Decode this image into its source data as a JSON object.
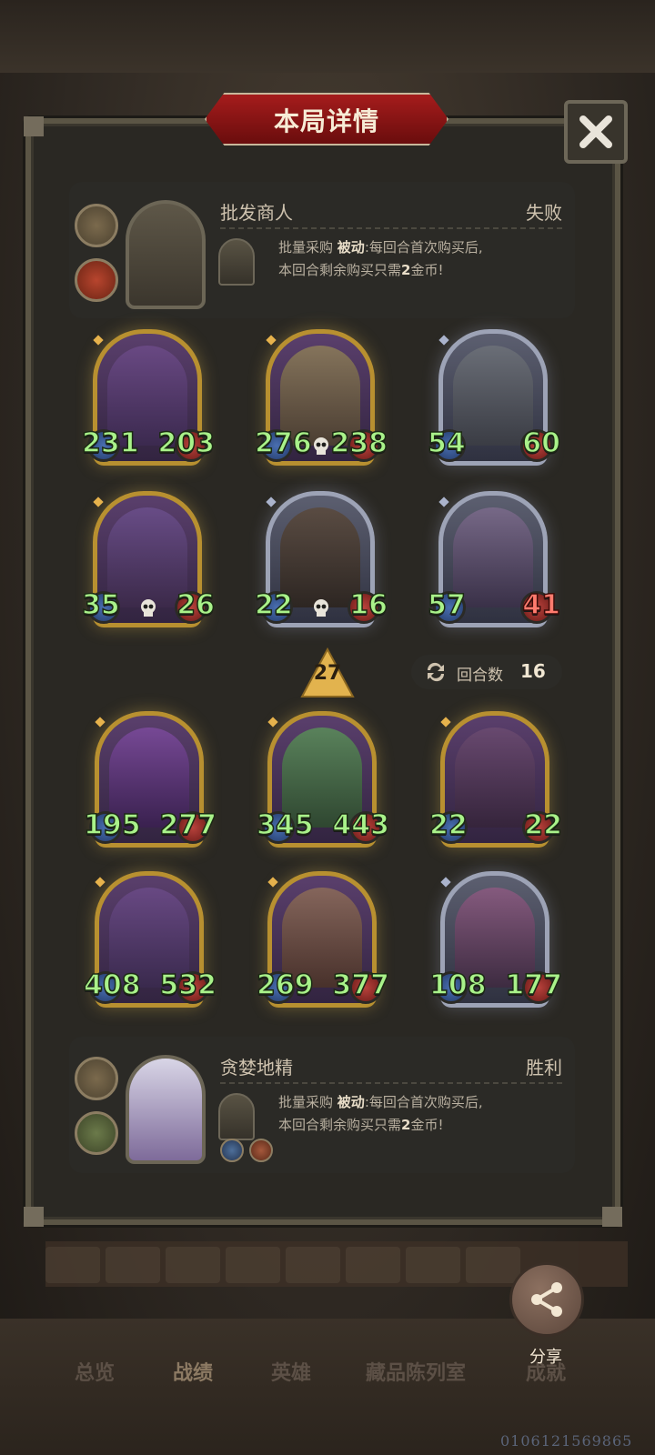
{
  "dialog": {
    "title": "本局详情",
    "close_icon": "close-icon"
  },
  "opponent": {
    "name": "批发商人",
    "result": "失败",
    "skill_name": "批量采购",
    "skill_type": "被动",
    "skill_desc_1": ":每回合首次购买后,",
    "skill_desc_2a": "本回合剩余购买只需",
    "skill_desc_2b": "2",
    "skill_desc_2c": "金币!"
  },
  "opponent_units": [
    {
      "atk": "231",
      "hp": "203",
      "frame": "gold",
      "dead": false
    },
    {
      "atk": "276",
      "hp": "238",
      "frame": "gold",
      "dead": true
    },
    {
      "atk": "54",
      "hp": "60",
      "frame": "silver",
      "dead": false
    },
    {
      "atk": "35",
      "hp": "26",
      "frame": "gold",
      "dead": true
    },
    {
      "atk": "22",
      "hp": "16",
      "frame": "silver",
      "dead": true
    },
    {
      "atk": "57",
      "hp": "41",
      "frame": "silver",
      "dead": false,
      "crit": true
    }
  ],
  "round": {
    "level": "27",
    "label": "回合数",
    "value": "16"
  },
  "player_units": [
    {
      "atk": "195",
      "hp": "277",
      "frame": "gold"
    },
    {
      "atk": "345",
      "hp": "443",
      "frame": "gold"
    },
    {
      "atk": "22",
      "hp": "22",
      "frame": "gold"
    },
    {
      "atk": "408",
      "hp": "532",
      "frame": "gold"
    },
    {
      "atk": "269",
      "hp": "377",
      "frame": "gold"
    },
    {
      "atk": "108",
      "hp": "177",
      "frame": "silver"
    }
  ],
  "player": {
    "name": "贪婪地精",
    "result": "胜利",
    "skill_name": "批量采购",
    "skill_type": "被动",
    "skill_desc_1": ":每回合首次购买后,",
    "skill_desc_2a": "本回合剩余购买只需",
    "skill_desc_2b": "2",
    "skill_desc_2c": "金币!"
  },
  "share": {
    "label": "分享"
  },
  "bottom_nav": [
    "总览",
    "战绩",
    "英雄",
    "藏品陈列室",
    "成就"
  ],
  "watermark": "0106121569865"
}
